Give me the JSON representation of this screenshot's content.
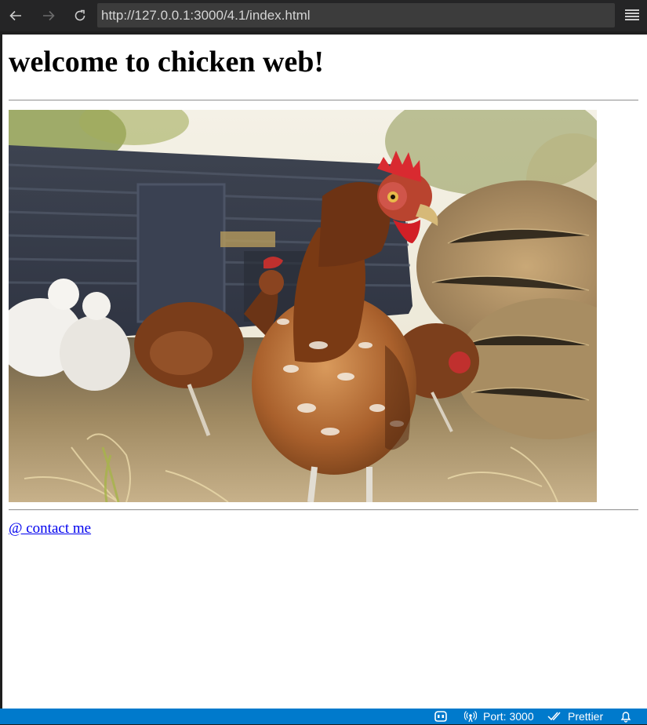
{
  "browser": {
    "url": "http://127.0.0.1:3000/4.1/index.html",
    "icons": {
      "back": "arrow-left-icon",
      "forward": "arrow-right-icon",
      "reload": "reload-icon",
      "menu": "hamburger-menu-icon"
    }
  },
  "page": {
    "title": "welcome to chicken web!",
    "image": {
      "subject": "chicken-photo"
    },
    "contact_link": "@ contact me"
  },
  "statusbar": {
    "accent": "#007acc",
    "port_label": "Port: 3000",
    "prettier_label": "Prettier",
    "icons": {
      "copilot": "copilot-icon",
      "port": "broadcast-icon",
      "prettier": "double-check-icon",
      "notifications": "bell-icon"
    }
  }
}
